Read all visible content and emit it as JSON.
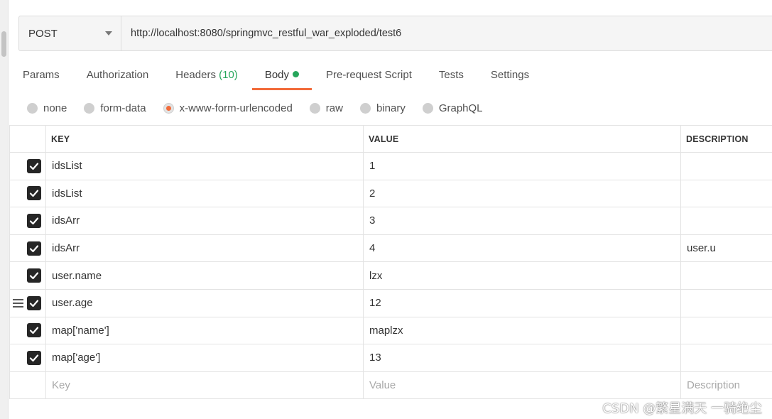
{
  "request": {
    "method": "POST",
    "url": "http://localhost:8080/springmvc_restful_war_exploded/test6"
  },
  "tabs": [
    {
      "label": "Params",
      "count": ""
    },
    {
      "label": "Authorization",
      "count": ""
    },
    {
      "label": "Headers",
      "count": "(10)"
    },
    {
      "label": "Body",
      "count": ""
    },
    {
      "label": "Pre-request Script",
      "count": ""
    },
    {
      "label": "Tests",
      "count": ""
    },
    {
      "label": "Settings",
      "count": ""
    }
  ],
  "active_tab": "Body",
  "body_types": [
    "none",
    "form-data",
    "x-www-form-urlencoded",
    "raw",
    "binary",
    "GraphQL"
  ],
  "selected_body_type": "x-www-form-urlencoded",
  "table": {
    "headers": {
      "key": "KEY",
      "value": "VALUE",
      "description": "DESCRIPTION"
    },
    "rows": [
      {
        "key": "idsList",
        "value": "1",
        "description": "",
        "checked": true
      },
      {
        "key": "idsList",
        "value": "2",
        "description": "",
        "checked": true
      },
      {
        "key": "idsArr",
        "value": "3",
        "description": "",
        "checked": true
      },
      {
        "key": "idsArr",
        "value": "4",
        "description": "user.u",
        "checked": true
      },
      {
        "key": "user.name",
        "value": "lzx",
        "description": "",
        "checked": true
      },
      {
        "key": "user.age",
        "value": "12",
        "description": "",
        "checked": true
      },
      {
        "key": "map['name']",
        "value": "maplzx",
        "description": "",
        "checked": true
      },
      {
        "key": "map['age']",
        "value": "13",
        "description": "",
        "checked": true
      }
    ],
    "placeholders": {
      "key": "Key",
      "value": "Value",
      "description": "Description"
    }
  },
  "watermark": "CSDN @繁星满天 一骑绝尘",
  "colors": {
    "accent": "#f26b3a",
    "success": "#26a65b",
    "checkbox": "#262626"
  }
}
